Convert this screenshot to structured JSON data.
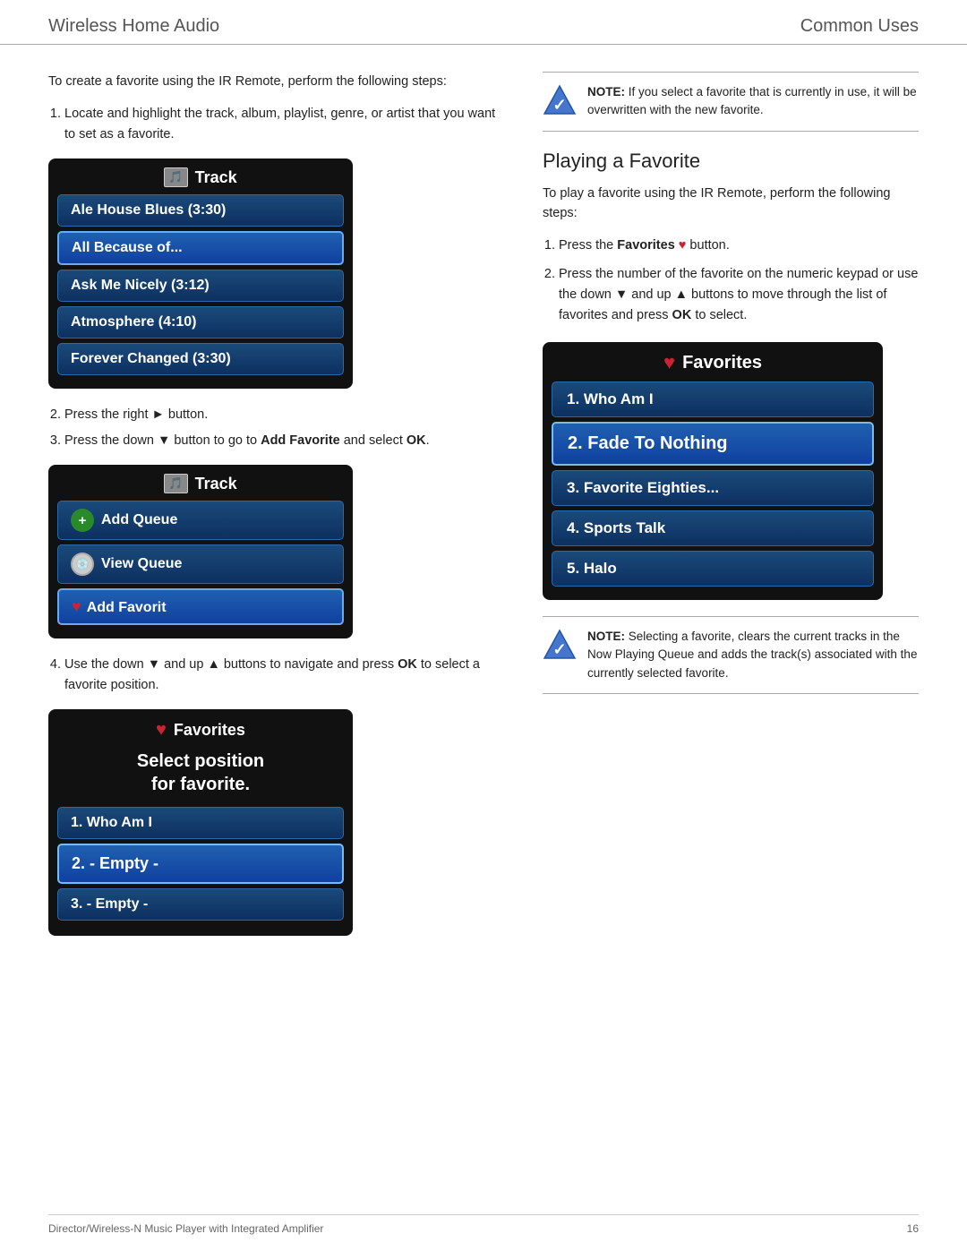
{
  "header": {
    "left": "Wireless Home Audio",
    "right": "Common Uses"
  },
  "left_col": {
    "intro": "To create a favorite using the IR Remote, perform the following steps:",
    "steps": [
      "Locate and highlight the track, album, playlist, genre, or artist that you want to set as a favorite.",
      "Press the right ▶ button.",
      "Press the down ▼ button to go to Add Favorite and select OK.",
      "Use the down ▼ and up ▲ buttons to navigate and press OK to select a favorite position."
    ],
    "step2_label": "Press the right",
    "step2_btn": "▶",
    "step2_suffix": "button.",
    "step3_label": "Press the down",
    "step3_btn": "▼",
    "step3_mid": "button to go to",
    "step3_bold": "Add Favorite",
    "step3_suffix": "and select",
    "step3_ok": "OK",
    "step3_end": ".",
    "step4_label": "Use the down",
    "step4_btn1": "▼",
    "step4_mid": "and up",
    "step4_btn2": "▲",
    "step4_suffix": "buttons to navigate and press",
    "step4_ok": "OK",
    "step4_end": "to select a favorite position.",
    "track_screen_1": {
      "title": "Track",
      "items": [
        {
          "label": "Ale House Blues (3:30)",
          "highlighted": false
        },
        {
          "label": "All Because of...",
          "highlighted": true
        },
        {
          "label": "Ask Me Nicely (3:12)",
          "highlighted": false
        },
        {
          "label": "Atmosphere (4:10)",
          "highlighted": false
        },
        {
          "label": "Forever Changed (3:30)",
          "highlighted": false
        }
      ]
    },
    "track_screen_2": {
      "title": "Track",
      "items": [
        {
          "label": "Add Queue",
          "icon": "queue",
          "highlighted": false
        },
        {
          "label": "View Queue",
          "icon": "cd",
          "highlighted": false
        },
        {
          "label": "Add Favorit",
          "icon": "heart",
          "highlighted": true
        }
      ]
    },
    "fav_select_screen": {
      "title": "Favorites",
      "subtitle": "Select position\nfor favorite.",
      "items": [
        {
          "label": "1. Who Am I",
          "highlighted": false
        },
        {
          "label": "2. - Empty -",
          "highlighted": true
        },
        {
          "label": "3. - Empty -",
          "highlighted": false
        }
      ]
    }
  },
  "right_col": {
    "note1": {
      "text_bold": "NOTE:",
      "text": " If you select a favorite that is currently in use, it will be overwritten with the new favorite."
    },
    "section_heading": "Playing a Favorite",
    "intro": "To play a favorite using the IR Remote, perform the following steps:",
    "steps": [
      {
        "text": "Press the ",
        "bold": "Favorites",
        "icon": "heart",
        "suffix": " button."
      },
      {
        "text": "Press the number of the favorite on the numeric keypad or use the down ▼ and up ▲ buttons to move through the list of favorites and press ",
        "bold": "OK",
        "suffix": " to select."
      }
    ],
    "fav_screen": {
      "title": "Favorites",
      "items": [
        {
          "label": "1. Who Am I",
          "highlighted": false
        },
        {
          "label": "2. Fade To Nothing",
          "highlighted": true
        },
        {
          "label": "3. Favorite Eighties...",
          "highlighted": false
        },
        {
          "label": "4. Sports Talk",
          "highlighted": false
        },
        {
          "label": "5. Halo",
          "highlighted": false
        }
      ]
    },
    "note2": {
      "text_bold": "NOTE:",
      "text": " Selecting a favorite, clears the current tracks in the Now Playing Queue and adds the track(s) associated with the currently selected favorite."
    }
  },
  "footer": {
    "left": "Director/Wireless-N Music Player with Integrated Amplifier",
    "right": "16"
  }
}
